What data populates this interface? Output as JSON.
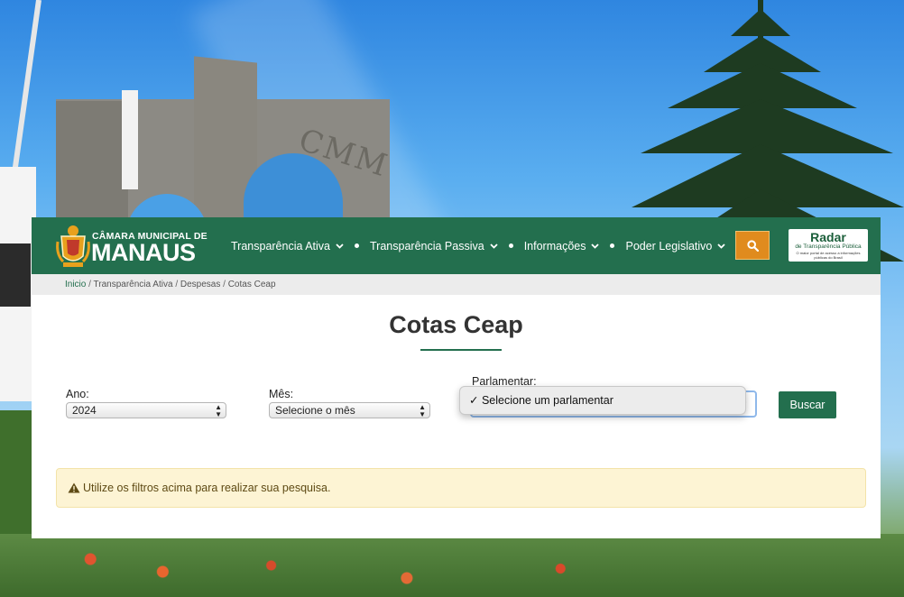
{
  "header": {
    "logo_top": "CÂMARA MUNICIPAL DE",
    "logo_main": "MANAUS",
    "nav": [
      {
        "label": "Transparência Ativa"
      },
      {
        "label": "Transparência Passiva"
      },
      {
        "label": "Informações"
      },
      {
        "label": "Poder Legislativo"
      }
    ],
    "search_icon": "search-icon",
    "radar": {
      "title": "Radar",
      "subtitle": "de Transparência Pública",
      "tagline": "O maior portal de acesso a informações públicas do Brasil"
    }
  },
  "breadcrumb": {
    "home": "Inicio",
    "items": [
      "Transparência Ativa",
      "Despesas",
      "Cotas Ceap"
    ],
    "separator": "/"
  },
  "page": {
    "title": "Cotas Ceap"
  },
  "filters": {
    "ano": {
      "label": "Ano:",
      "value": "2024"
    },
    "mes": {
      "label": "Mês:",
      "value": "Selecione o mês"
    },
    "parlamentar": {
      "label": "Parlamentar:",
      "value": "Selecione um parlamentar"
    },
    "search_button": "Buscar"
  },
  "alert": {
    "text": "Utilize os filtros acima para realizar sua pesquisa.",
    "icon": "warning-icon"
  },
  "colors": {
    "brand_green": "#236f4e",
    "search_orange": "#e08b1e",
    "alert_bg": "#fdf4d4"
  }
}
